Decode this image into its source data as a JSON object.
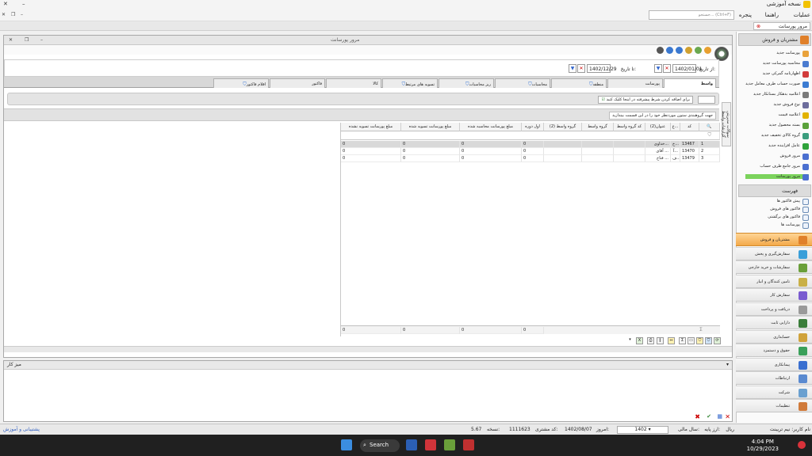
{
  "app": {
    "title": "نسخه آموزشی",
    "min": "–",
    "restore": "❐",
    "close": "✕"
  },
  "menu": {
    "items": [
      "عملیات",
      "راهنما",
      "پنجره"
    ],
    "search_placeholder": "جستجو... (Ctrl+F)"
  },
  "doc_tab": {
    "label": "مرور پورسانت"
  },
  "window": {
    "title": "مرور پورسانت"
  },
  "dates": {
    "from_label": "از تاریخ:",
    "from_value": "1402/01/01",
    "to_label": "تا تاریخ:",
    "to_value": "1402/12/29"
  },
  "filter_tabs": [
    {
      "label": "واسط",
      "active": true
    },
    {
      "label": "پورسانت"
    },
    {
      "label": "منطقه"
    },
    {
      "label": "محاسبات"
    },
    {
      "label": "ریز محاسبات"
    },
    {
      "label": "تسویه های مرتبط"
    },
    {
      "label": "کالا"
    },
    {
      "label": "فاکتور"
    },
    {
      "label": "اقلام فاکتور"
    }
  ],
  "condition_text": "برای اضافه کردن شرط پیشرفته در اینجا کلیک کنید",
  "group_text": "جهت گروهبندی ستون موردنظر خود را در این قسمت بیندازید",
  "side_vertical_label": "سوالات مدیریتی گزارشات واسط",
  "grid": {
    "columns": [
      "کد",
      "ع...",
      "عنوان(2)",
      "کد گروه واسط",
      "گروه واسط",
      "گروه واسط (2)",
      "اول دوره",
      "مبلغ پورسانت محاسبه شده",
      "مبلغ پورسانت تسویه شده",
      "مبلغ پورسانت تسویه نشده"
    ],
    "rows": [
      {
        "n": "1",
        "code": "13467",
        "a": "خ...",
        "title": "خداوی...",
        "c1": "0",
        "c2": "0",
        "c3": "0",
        "c4": "0"
      },
      {
        "n": "2",
        "code": "13470",
        "a": "آ...",
        "title": "آقای ...",
        "c1": "0",
        "c2": "0",
        "c3": "0",
        "c4": "0"
      },
      {
        "n": "3",
        "code": "13479",
        "a": "ف...",
        "title": "فتاح ...",
        "c1": "0",
        "c2": "0",
        "c3": "0",
        "c4": "0"
      }
    ],
    "totals": {
      "c1": "0",
      "c2": "0",
      "c3": "0",
      "c4": "0"
    }
  },
  "memo": {
    "title": "میز کار"
  },
  "status": {
    "company": "نام کاربر: نیم تریبنت",
    "fiscal_label": "سال مالی:",
    "year": "1402",
    "currency_label": "ارز پایه:",
    "currency": "ریال",
    "today_label": "امروز:",
    "today": "1402/08/07",
    "user_code_label": "کد مشتری:",
    "user_code": "1111623",
    "version_label": "نسخه:",
    "version": "5.67",
    "support_link": "پشتیبانی و آموزش"
  },
  "taskbar": {
    "search_label": "Search",
    "time": "4:04 PM",
    "date": "10/29/2023"
  },
  "rightpane": {
    "section1_title": "مشتریان و فروش",
    "section1_items": [
      {
        "label": "پورسانت جدید",
        "color": "#e9a23b"
      },
      {
        "label": "محاسبه پورسانت جدید",
        "color": "#4a7bd0"
      },
      {
        "label": "اظهارنامه گمرکی جدید",
        "color": "#d23b3b"
      },
      {
        "label": "صورت حساب طرف معامل جدید",
        "color": "#3b7bd2"
      },
      {
        "label": "اعلامیه بدهکار بستانکار جدید",
        "color": "#7a7a7a"
      },
      {
        "label": "نوع فروش جدید",
        "color": "#6c6c9c"
      },
      {
        "label": "اعلامیه قیمت",
        "color": "#e2b300"
      },
      {
        "label": "بسته محصول جدید",
        "color": "#5aa13a"
      },
      {
        "label": "گروه کالای تخفیف جدید",
        "color": "#3a9d7d"
      },
      {
        "label": "عامل افزاینده جدید",
        "color": "#2fa33b"
      },
      {
        "label": "مرور فروش",
        "color": "#4a6fd0"
      },
      {
        "label": "مرور جامع طرف حساب",
        "color": "#4a6fd0"
      },
      {
        "label": "مرور پورسانت",
        "color": "#4a6fd0",
        "active": true
      }
    ],
    "section2_title": "فهرست",
    "section2_items": [
      {
        "label": "پیش فاکتور ها"
      },
      {
        "label": "فاکتور های فروش"
      },
      {
        "label": "فاکتور های برگشتی"
      },
      {
        "label": "پورسانت ها"
      }
    ],
    "modules": [
      {
        "label": "مشتریان و فروش",
        "active": true,
        "color": "#e0802a"
      },
      {
        "label": "سفارش‌گیری و پخش",
        "color": "#3a9fd9"
      },
      {
        "label": "سفارشات و خرید خارجی",
        "color": "#6a9f3a"
      },
      {
        "label": "تامین کنندگان و انبار",
        "color": "#c9b046"
      },
      {
        "label": "سفارش کار",
        "color": "#7a5bd0"
      },
      {
        "label": "دریافت و پرداخت",
        "color": "#9a9a9a"
      },
      {
        "label": "دارایی ثابت",
        "color": "#3a7d3a"
      },
      {
        "label": "حسابداری",
        "color": "#d0a23a"
      },
      {
        "label": "حقوق و دستمزد",
        "color": "#3aa05a"
      },
      {
        "label": "پیمانکاری",
        "color": "#3a6fd0"
      },
      {
        "label": "ارتباطات",
        "color": "#5a8ad0"
      },
      {
        "label": "شرکت",
        "color": "#6aa0d0"
      },
      {
        "label": "تنظیمات",
        "color": "#d07a3a"
      }
    ]
  }
}
